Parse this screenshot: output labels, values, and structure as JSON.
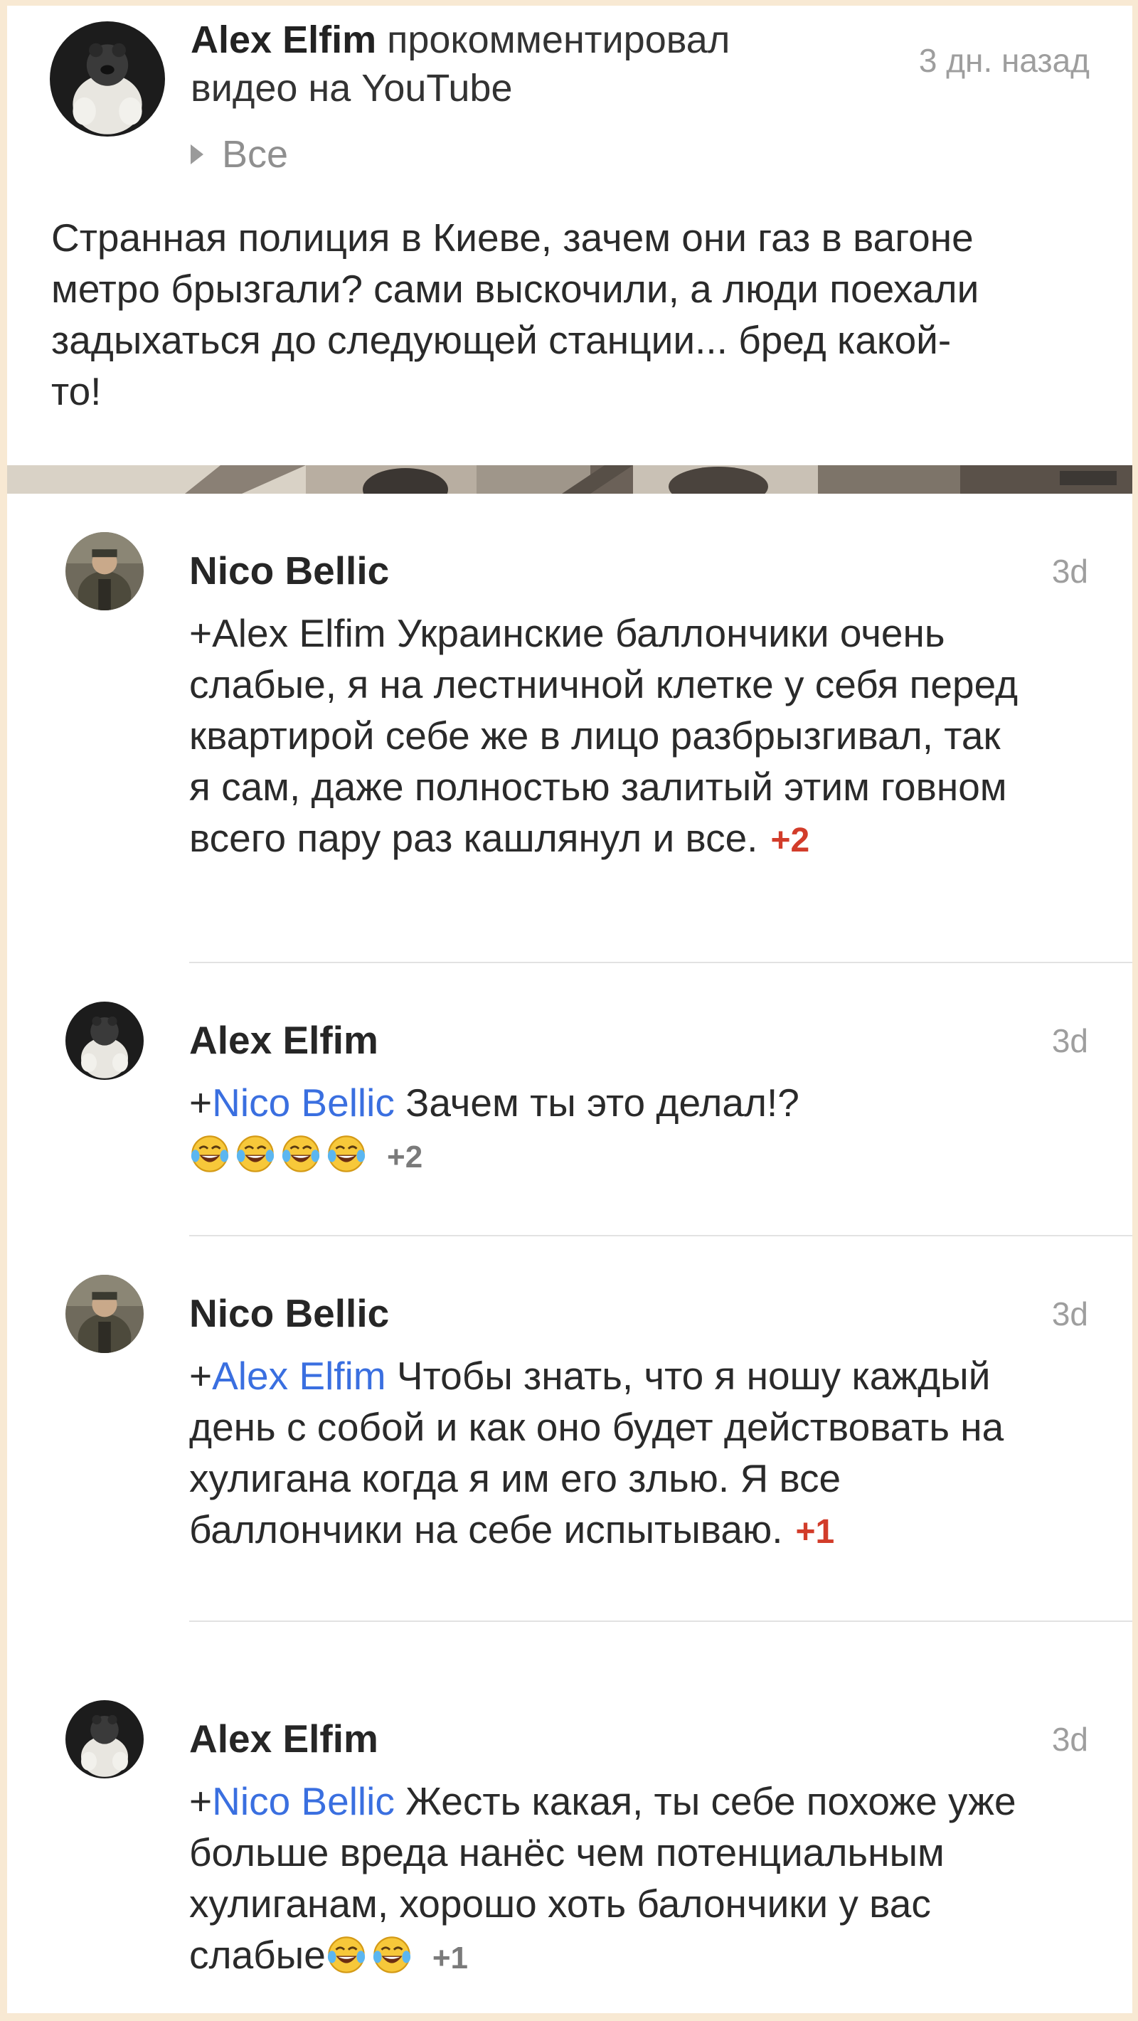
{
  "post": {
    "author": "Alex Elfim",
    "action_line1": " прокомментировал",
    "action_line2": "видео на YouTube",
    "time": "3 дн. назад",
    "expand_label": "Все",
    "text": "Странная полиция в Киеве, зачем они газ в вагоне метро брызгали? сами выскочили, а люди поехали задыхаться до следующей станции... бред какой-то!"
  },
  "comments": [
    {
      "author": "Nico Bellic",
      "time": "3d",
      "mention": "+Alex Elfim",
      "mention_style": "plain",
      "text": " Украинские баллончики очень слабые, я на лестничной клетке у себя перед квартирой себе же в лицо разбрызгивал, так я сам, даже полностью залитый этим говном всего пару раз кашлянул и все.",
      "plus": "+2",
      "plus_color": "red",
      "emoji_count": 0
    },
    {
      "author": "Alex Elfim",
      "time": "3d",
      "mention": "Nico Bellic",
      "mention_style": "link",
      "text": " Зачем ты это делал!?",
      "plus": "+2",
      "plus_color": "grey",
      "emoji_count": 4
    },
    {
      "author": "Nico Bellic",
      "time": "3d",
      "mention": "Alex Elfim",
      "mention_style": "link",
      "text": " Чтобы знать, что я ношу каждый день с собой и как оно будет действовать на хулигана когда я им его злью. Я все баллончики на себе испытываю.",
      "plus": "+1",
      "plus_color": "red",
      "emoji_count": 0
    },
    {
      "author": "Alex Elfim",
      "time": "3d",
      "mention": "Nico Bellic",
      "mention_style": "link",
      "text": " Жесть какая, ты себе похоже уже больше вреда нанёс чем потенциальным хулиганам, хорошо хоть балончики у вас слабые",
      "plus": "+1",
      "plus_color": "grey",
      "emoji_count": 2
    }
  ],
  "colors": {
    "background_frame": "#f8e9d3",
    "mention_link": "#3a6fe0",
    "plus_red": "#d23c2a",
    "plus_grey": "#7a7a7a",
    "muted_time": "#9e9e9e"
  },
  "icons": {
    "expand": "triangle-right-icon",
    "emoji": "face-with-tears-of-joy-icon"
  }
}
